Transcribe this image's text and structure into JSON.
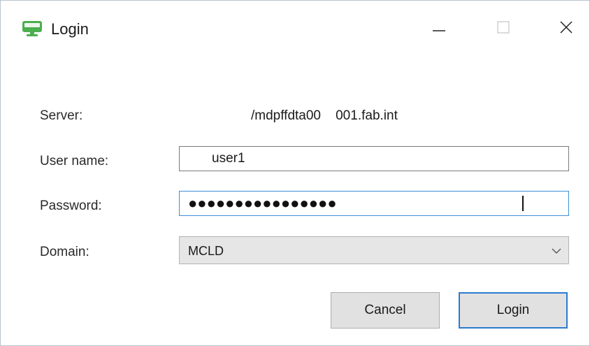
{
  "window": {
    "title": "Login",
    "app_icon": "monitor-icon",
    "controls": {
      "minimize_icon": "minimize-icon",
      "maximize_icon": "maximize-icon",
      "close_icon": "close-icon"
    }
  },
  "form": {
    "server": {
      "label": "Server:",
      "value": "/mdpffdta00    001.fab.int"
    },
    "username": {
      "label": "User name:",
      "value": "user1"
    },
    "password": {
      "label": "Password:",
      "mask": "●●●●●●●●●●●●●●●●"
    },
    "domain": {
      "label": "Domain:",
      "selected": "MCLD",
      "arrow_icon": "chevron-down-icon"
    }
  },
  "buttons": {
    "cancel_label": "Cancel",
    "login_label": "Login"
  },
  "colors": {
    "app_icon_green": "#4caf50",
    "focus_border": "#3c8fd6",
    "default_button_border": "#2b7bd0",
    "button_face": "#e1e1e1",
    "select_face": "#e6e6e6"
  }
}
